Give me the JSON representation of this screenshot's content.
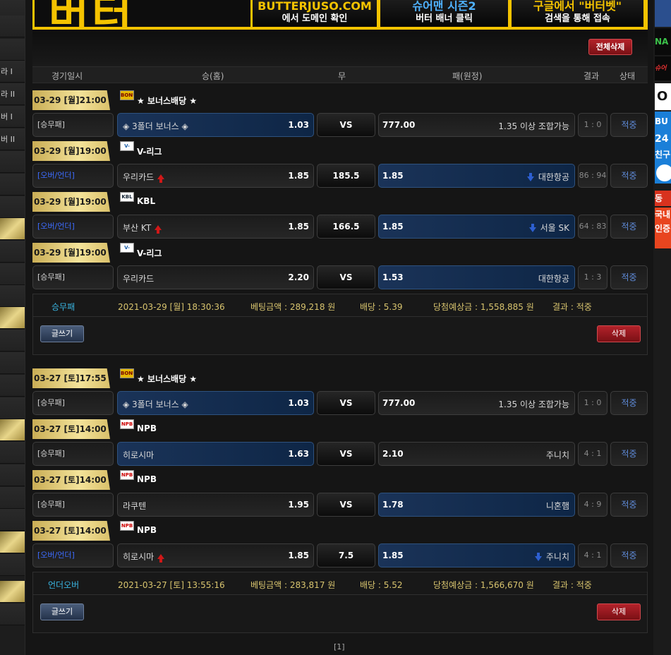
{
  "colors": {
    "gold": "#f4e39a",
    "banner_yellow": "#f5c300",
    "delete_red": "#b3222a",
    "status_blue": "#5f8bd9"
  },
  "left_sidebar": {
    "items": [
      "",
      "",
      "",
      "라 I",
      "라 II",
      "버 I",
      "버 II",
      "",
      "",
      "",
      "",
      "",
      "",
      "",
      "",
      "",
      "",
      "",
      "",
      "",
      "",
      "",
      "",
      "",
      "",
      "",
      "",
      ""
    ]
  },
  "right_sidebar": {
    "items": [
      "NA",
      "슈어",
      "O",
      "BU",
      "24",
      "친구",
      "동",
      "국내",
      "인증"
    ]
  },
  "banner": {
    "logo": "버터",
    "items": [
      {
        "line1": "BUTTERJUSO.COM",
        "line2": "에서 도메인 확인"
      },
      {
        "line1": "슈어맨 시즌2",
        "line2": "버터 배너 클릭"
      },
      {
        "line1": "구글에서 \"버터벳\"",
        "line2": "검색을 통해 접속"
      }
    ]
  },
  "toolbar": {
    "delete_all": "전체삭제"
  },
  "columns": {
    "date": "경기일시",
    "home": "승(홈)",
    "draw": "무",
    "away": "패(원정)",
    "result": "결과",
    "status": "상태"
  },
  "bets": [
    {
      "games": [
        {
          "datetime": "03-29 [월]21:00",
          "league_icon": "BONUS",
          "league": "★ 보너스배당 ★",
          "type": "[승무패]",
          "home": "◈ 3폴더 보너스 ◈",
          "home_odds": "1.03",
          "mid": "VS",
          "away_odds": "777.00",
          "away": "1.35 이상 조합가능",
          "score": "1 : 0",
          "status": "적중"
        },
        {
          "datetime": "03-29 [월]19:00",
          "league_icon": "V-LEAGUE",
          "league": "V-리그",
          "type": "[오버/언더]",
          "home": "우리카드",
          "home_odds": "1.85",
          "mid": "185.5",
          "away_odds": "1.85",
          "away": "대한항공",
          "score": "86 : 94",
          "status": "적중"
        },
        {
          "datetime": "03-29 [월]19:00",
          "league_icon": "KBL",
          "league": "KBL",
          "type": "[오버/언더]",
          "home": "부산 KT",
          "home_odds": "1.85",
          "mid": "166.5",
          "away_odds": "1.85",
          "away": "서울 SK",
          "score": "64 : 83",
          "status": "적중"
        },
        {
          "datetime": "03-29 [월]19:00",
          "league_icon": "V-LEAGUE",
          "league": "V-리그",
          "type": "[승무패]",
          "home": "우리카드",
          "home_odds": "2.20",
          "mid": "VS",
          "away_odds": "1.53",
          "away": "대한항공",
          "score": "1 : 3",
          "status": "적중"
        }
      ],
      "summary": {
        "type": "승무패",
        "date": "2021-03-29 [월] 18:30:36",
        "amount": "베팅금액 : 289,218 원",
        "odds": "배당 : 5.39",
        "expected": "당첨예상금 : 1,558,885 원",
        "result": "결과 : 적중",
        "write_btn": "글쓰기",
        "delete_btn": "삭제"
      }
    },
    {
      "games": [
        {
          "datetime": "03-27 [토]17:55",
          "league_icon": "BONUS",
          "league": "★ 보너스배당 ★",
          "type": "[승무패]",
          "home": "◈ 3폴더 보너스 ◈",
          "home_odds": "1.03",
          "mid": "VS",
          "away_odds": "777.00",
          "away": "1.35 이상 조합가능",
          "score": "1 : 0",
          "status": "적중"
        },
        {
          "datetime": "03-27 [토]14:00",
          "league_icon": "NPB",
          "league": "NPB",
          "type": "[승무패]",
          "home": "히로시마",
          "home_odds": "1.63",
          "mid": "VS",
          "away_odds": "2.10",
          "away": "주니치",
          "score": "4 : 1",
          "status": "적중"
        },
        {
          "datetime": "03-27 [토]14:00",
          "league_icon": "NPB",
          "league": "NPB",
          "type": "[승무패]",
          "home": "라쿠텐",
          "home_odds": "1.95",
          "mid": "VS",
          "away_odds": "1.78",
          "away": "니혼햄",
          "score": "4 : 9",
          "status": "적중"
        },
        {
          "datetime": "03-27 [토]14:00",
          "league_icon": "NPB",
          "league": "NPB",
          "type": "[오버/언더]",
          "home": "히로시마",
          "home_odds": "1.85",
          "mid": "7.5",
          "away_odds": "1.85",
          "away": "주니치",
          "score": "4 : 1",
          "status": "적중"
        }
      ],
      "summary": {
        "type": "언더오버",
        "date": "2021-03-27 [토] 13:55:16",
        "amount": "베팅금액 : 283,817 원",
        "odds": "배당 : 5.52",
        "expected": "당첨예상금 : 1,566,670 원",
        "result": "결과 : 적중",
        "write_btn": "글쓰기",
        "delete_btn": "삭제"
      }
    }
  ],
  "pager": {
    "label": "[1]"
  }
}
